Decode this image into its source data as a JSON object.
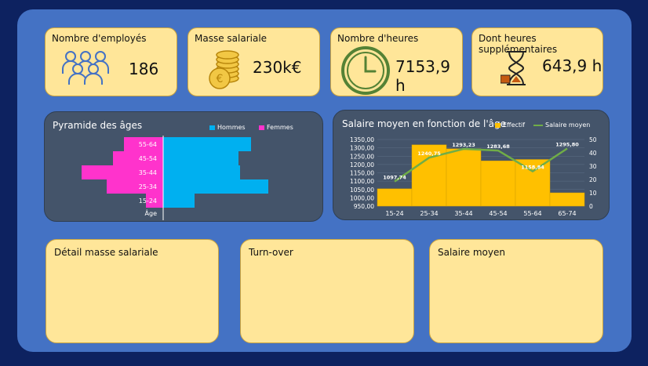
{
  "kpis": {
    "employees": {
      "title": "Nombre d'employés",
      "value": "186",
      "icon": "people-icon"
    },
    "payroll": {
      "title": "Masse salariale",
      "value": "230k€",
      "icon": "coins-icon"
    },
    "hours": {
      "title": "Nombre d'heures",
      "value": "7153,9 h",
      "icon": "clock-icon"
    },
    "overtime": {
      "title": "Dont heures supplémentaires",
      "value": "643,9 h",
      "icon": "hourglass-icon"
    }
  },
  "colors": {
    "board": "#4472c4",
    "kpi_bg": "#ffe699",
    "dark_panel": "#44546a",
    "hommes": "#00b0f0",
    "femmes": "#ff33cc",
    "effectif": "#ffc000",
    "salaire": "#70ad47"
  },
  "pyramid": {
    "title": "Pyramide des âges",
    "legend": {
      "hommes": "Hommes",
      "femmes": "Femmes"
    },
    "axis_label": "Âge"
  },
  "salary_chart": {
    "title": "Salaire moyen en fonction de l'âge",
    "legend": {
      "effectif": "Effectif",
      "salaire": "Salaire moyen"
    }
  },
  "cards": {
    "payroll_detail": "Détail masse salariale",
    "turnover": "Turn-over",
    "avg_salary": "Salaire moyen"
  },
  "chart_data": [
    {
      "type": "bar",
      "orientation": "horizontal",
      "title": "Pyramide des âges",
      "categories": [
        "15-24",
        "25-34",
        "35-44",
        "45-54",
        "55-64"
      ],
      "series": [
        {
          "name": "Hommes",
          "values": [
            20,
            67,
            49,
            48,
            56
          ]
        },
        {
          "name": "Femmes",
          "values": [
            -11,
            -36,
            -52,
            -32,
            -25
          ]
        }
      ],
      "ylabel": "Âge",
      "legend": "top-right"
    },
    {
      "type": "bar",
      "title": "Salaire moyen en fonction de l'âge",
      "categories": [
        "15-24",
        "25-34",
        "35-44",
        "45-54",
        "55-64",
        "65-74"
      ],
      "series": [
        {
          "name": "Effectif",
          "type": "bar",
          "axis": "right",
          "values": [
            13,
            46,
            43,
            34,
            35,
            10
          ]
        },
        {
          "name": "Salaire moyen",
          "type": "line",
          "axis": "left",
          "values": [
            1097.74,
            1240.75,
            1293.23,
            1283.68,
            1158.84,
            1295.8
          ],
          "labels": [
            "1097,74",
            "1240,75",
            "1293,23",
            "1283,68",
            "1158,84",
            "1295,80"
          ]
        }
      ],
      "y_left_ticks": [
        "950,00",
        "1000,00",
        "1050,00",
        "1100,00",
        "1150,00",
        "1200,00",
        "1250,00",
        "1300,00",
        "1350,00"
      ],
      "y_left_range": [
        950,
        1350
      ],
      "y_right_ticks": [
        "0",
        "10",
        "20",
        "30",
        "40",
        "50"
      ],
      "y_right_range": [
        0,
        50
      ],
      "legend": "top-right"
    }
  ]
}
